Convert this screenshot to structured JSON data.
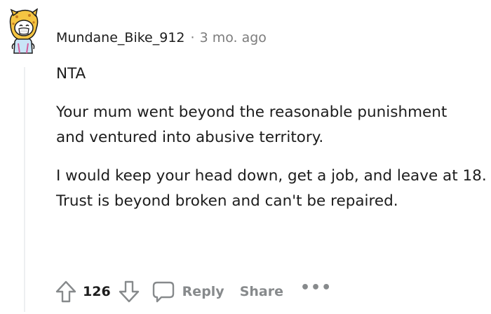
{
  "comment": {
    "author": "Mundane_Bike_912",
    "separator": "·",
    "timestamp": "3 mo. ago",
    "paragraphs": [
      "NTA",
      "Your mum went beyond the reasonable punishment and ventured into abusive territory.",
      "I would keep your head down, get a job, and leave at 18. Trust is beyond broken and can't be repaired."
    ],
    "score": "126",
    "actions": {
      "reply_label": "Reply",
      "share_label": "Share",
      "more_label": "•••"
    }
  },
  "colors": {
    "text": "#1c1c1c",
    "muted": "#7c7c7c",
    "action": "#878a8c",
    "thread_line": "#edeff1",
    "avatar_yellow": "#f5c542"
  },
  "icons": {
    "upvote": "arrow-up-outline",
    "downvote": "arrow-down-outline",
    "reply": "speech-bubble-outline",
    "more": "horizontal-ellipsis"
  }
}
